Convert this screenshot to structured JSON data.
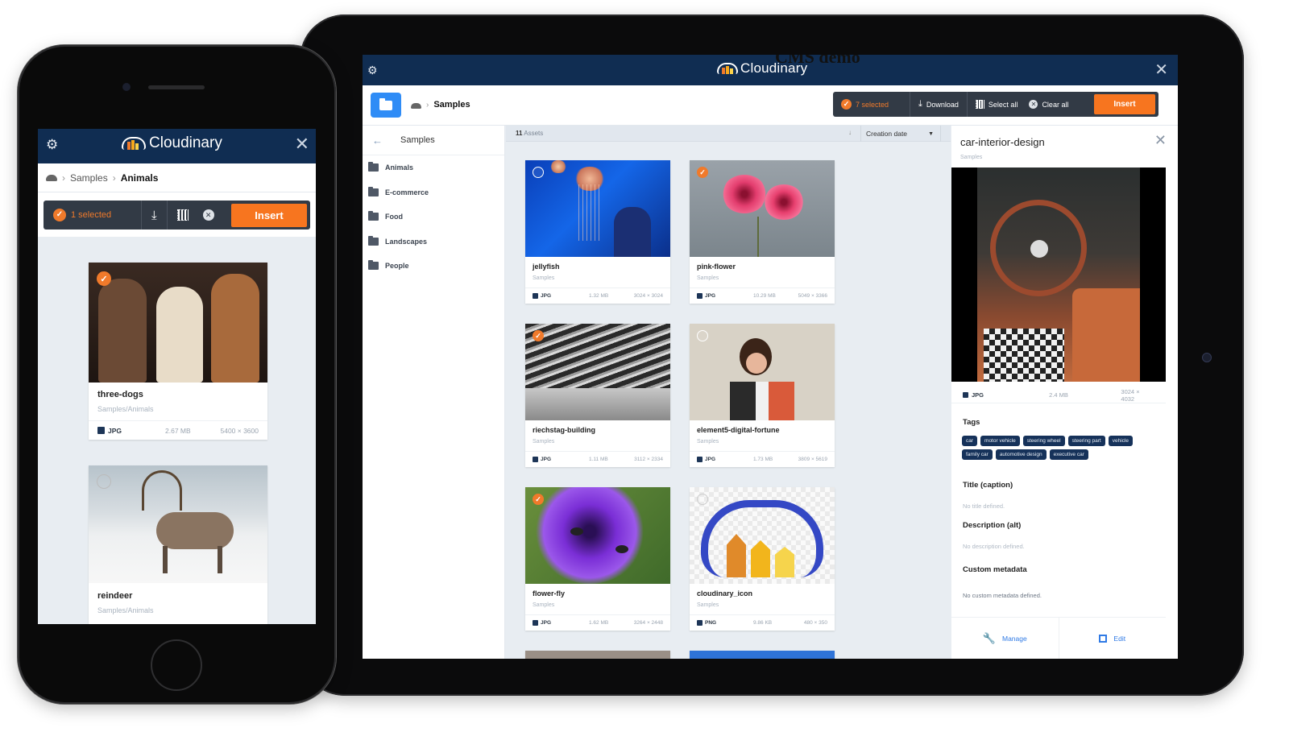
{
  "tablet": {
    "overlay_title": "CMS demo",
    "app": {
      "brand": "Cloudinary",
      "settings_icon": "gear-icon",
      "close_icon": "close-icon"
    },
    "breadcrumb": {
      "root_icon": "cloud-icon",
      "current": "Samples"
    },
    "actionbar": {
      "selected": "7 selected",
      "download": "Download",
      "select_all": "Select all",
      "clear_all": "Clear all",
      "insert": "Insert",
      "accent": "#f7751f"
    },
    "sidebar": {
      "header": "Samples",
      "items": [
        {
          "label": "Animals"
        },
        {
          "label": "E-commerce"
        },
        {
          "label": "Food"
        },
        {
          "label": "Landscapes"
        },
        {
          "label": "People"
        }
      ]
    },
    "assets": {
      "count": "11",
      "count_label": "Assets",
      "sort_by": "Creation date",
      "items": [
        {
          "name": "jellyfish",
          "folder": "Samples",
          "format": "JPG",
          "size": "1.32 MB",
          "dimensions": "3024 × 3024",
          "selected": false
        },
        {
          "name": "pink-flower",
          "folder": "Samples",
          "format": "JPG",
          "size": "10.29 MB",
          "dimensions": "5049 × 3366",
          "selected": true
        },
        {
          "name": "riechstag-building",
          "folder": "Samples",
          "format": "JPG",
          "size": "1.11 MB",
          "dimensions": "3112 × 2334",
          "selected": true
        },
        {
          "name": "element5-digital-fortune",
          "folder": "Samples",
          "format": "JPG",
          "size": "1.73 MB",
          "dimensions": "3809 × 5619",
          "selected": false
        },
        {
          "name": "flower-fly",
          "folder": "Samples",
          "format": "JPG",
          "size": "1.62 MB",
          "dimensions": "3264 × 2448",
          "selected": true
        },
        {
          "name": "cloudinary_icon",
          "folder": "Samples",
          "format": "PNG",
          "size": "9.86 KB",
          "dimensions": "480 × 350",
          "selected": false
        }
      ]
    },
    "details": {
      "title": "car-interior-design",
      "folder": "Samples",
      "format": "JPG",
      "size": "2.4 MB",
      "dimensions": "3024 × 4032",
      "tags_label": "Tags",
      "tags": [
        "car",
        "motor vehicle",
        "steering wheel",
        "steering part",
        "vehicle",
        "family car",
        "automotive design",
        "executive car"
      ],
      "title_label": "Title (caption)",
      "title_value": "No title defined.",
      "description_label": "Description (alt)",
      "description_value": "No description defined.",
      "custom_label": "Custom metadata",
      "custom_value": "No custom metadata defined.",
      "manage": "Manage",
      "edit": "Edit"
    }
  },
  "phone": {
    "app": {
      "brand": "Cloudinary"
    },
    "breadcrumb": {
      "items": [
        "Samples"
      ],
      "current": "Animals"
    },
    "actionbar": {
      "selected": "1 selected",
      "insert": "Insert"
    },
    "assets": [
      {
        "name": "three-dogs",
        "folder": "Samples/Animals",
        "format": "JPG",
        "size": "2.67 MB",
        "dimensions": "5400 × 3600",
        "selected": true
      },
      {
        "name": "reindeer",
        "folder": "Samples/Animals",
        "selected": false
      }
    ]
  }
}
